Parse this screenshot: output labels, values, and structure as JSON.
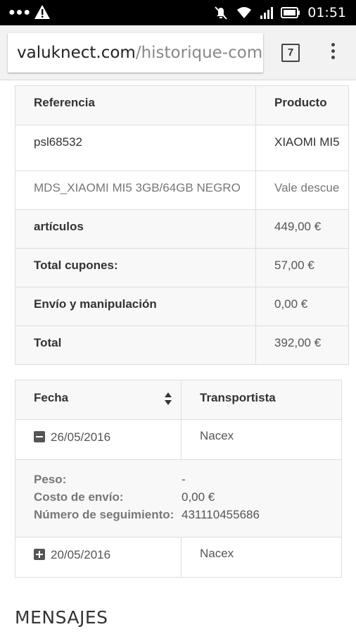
{
  "status_bar": {
    "time": "01:51",
    "icons": [
      "more-dots-icon",
      "warning-icon",
      "silent-icon",
      "wifi-icon",
      "signal-icon",
      "battery-icon"
    ]
  },
  "browser": {
    "url_host": "valuknect.com",
    "url_path": "/historique-comr",
    "tab_count": "7"
  },
  "order_table": {
    "headers": [
      "Referencia",
      "Producto"
    ],
    "rows": [
      [
        "psl68532",
        "XIAOMI MI5"
      ],
      [
        "MDS_XIAOMI MI5 3GB/64GB NEGRO",
        "Vale descue"
      ]
    ],
    "totals": [
      {
        "label": "artículos",
        "value": "449,00 €"
      },
      {
        "label": "Total cupones:",
        "value": "57,00 €"
      },
      {
        "label": "Envío y manipulación",
        "value": "0,00 €"
      },
      {
        "label": "Total",
        "value": "392,00 €"
      }
    ]
  },
  "shipping_table": {
    "headers": [
      "Fecha",
      "Transportista"
    ],
    "shipments": [
      {
        "date": "26/05/2016",
        "carrier": "Nacex",
        "expanded": true,
        "details": [
          {
            "label": "Peso:",
            "value": "-"
          },
          {
            "label": "Costo de envío:",
            "value": "0,00 €"
          },
          {
            "label": "Número de seguimiento:",
            "value": "431110455686"
          }
        ]
      },
      {
        "date": "20/05/2016",
        "carrier": "Nacex",
        "expanded": false
      }
    ]
  },
  "messages_title": "MENSAJES"
}
